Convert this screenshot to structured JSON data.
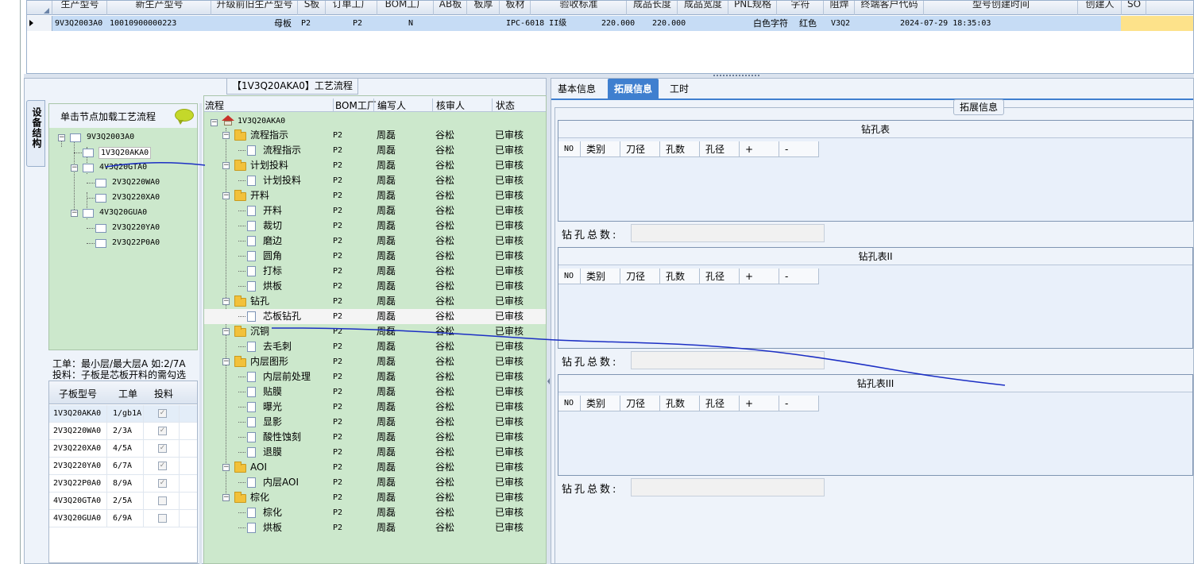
{
  "top_grid": {
    "headers": [
      "生产型号",
      "新生产型号",
      "升级前旧生产型号",
      "S板",
      "订单工厂",
      "BOM工厂",
      "AB板",
      "板厚",
      "板材",
      "验收标准",
      "成品长度",
      "成品宽度",
      "PNL规格",
      "字符",
      "阻焊",
      "终端客户代码",
      "型号创建时间",
      "创建人",
      "SO"
    ],
    "row": {
      "model": "9V3Q2003A0",
      "new_model": "10010900000223",
      "board_type": "母板",
      "order_factory": "P2",
      "bom_factory": "P2",
      "ab_board": "N",
      "standard": "IPC-6018 II级",
      "length": "220.000",
      "width": "220.000",
      "character": "白色字符",
      "solder_mask": "红色",
      "customer_code": "V3Q2",
      "created_time": "2024-07-29 18:35:03"
    }
  },
  "left_panel": {
    "title": "【1V3Q20AKA0】工艺流程",
    "vertical_tab": "设备结构",
    "hint": "单击节点加载工艺流程",
    "tree": [
      {
        "label": "9V3Q2003A0"
      },
      {
        "label": "1V3Q20AKA0"
      },
      {
        "label": "4V3Q20GTA0"
      },
      {
        "label": "2V3Q220WA0"
      },
      {
        "label": "2V3Q220XA0"
      },
      {
        "label": "4V3Q20GUA0"
      },
      {
        "label": "2V3Q220YA0"
      },
      {
        "label": "2V3Q22P0A0"
      }
    ],
    "note_line1": "工单：最小层/最大层A 如:2/7A",
    "note_line2": "投料：子板是芯板开料的需勾选",
    "sub_table": {
      "headers": [
        "子板型号",
        "工单",
        "投料"
      ],
      "rows": [
        {
          "model": "1V3Q20AKA0",
          "order": "1/gb1A",
          "feed": true
        },
        {
          "model": "2V3Q220WA0",
          "order": "2/3A",
          "feed": true
        },
        {
          "model": "2V3Q220XA0",
          "order": "4/5A",
          "feed": true
        },
        {
          "model": "2V3Q220YA0",
          "order": "6/7A",
          "feed": true
        },
        {
          "model": "2V3Q22P0A0",
          "order": "8/9A",
          "feed": true
        },
        {
          "model": "4V3Q20GTA0",
          "order": "2/5A",
          "feed": false
        },
        {
          "model": "4V3Q20GUA0",
          "order": "6/9A",
          "feed": false
        }
      ],
      "check_mark": "✓"
    },
    "flow": {
      "headers": [
        "流程",
        "BOM工厂",
        "编写人",
        "核审人",
        "状态"
      ],
      "root": "1V3Q20AKA0",
      "rows": [
        {
          "name": "流程指示",
          "type": "folder",
          "factory": "P2",
          "writer": "周磊",
          "reviewer": "谷松",
          "status": "已审核"
        },
        {
          "name": "流程指示",
          "type": "doc",
          "factory": "P2",
          "writer": "周磊",
          "reviewer": "谷松",
          "status": "已审核"
        },
        {
          "name": "计划投料",
          "type": "folder",
          "factory": "P2",
          "writer": "周磊",
          "reviewer": "谷松",
          "status": "已审核"
        },
        {
          "name": "计划投料",
          "type": "doc",
          "factory": "P2",
          "writer": "周磊",
          "reviewer": "谷松",
          "status": "已审核"
        },
        {
          "name": "开料",
          "type": "folder",
          "factory": "P2",
          "writer": "周磊",
          "reviewer": "谷松",
          "status": "已审核"
        },
        {
          "name": "开料",
          "type": "doc",
          "factory": "P2",
          "writer": "周磊",
          "reviewer": "谷松",
          "status": "已审核"
        },
        {
          "name": "裁切",
          "type": "doc",
          "factory": "P2",
          "writer": "周磊",
          "reviewer": "谷松",
          "status": "已审核"
        },
        {
          "name": "磨边",
          "type": "doc",
          "factory": "P2",
          "writer": "周磊",
          "reviewer": "谷松",
          "status": "已审核"
        },
        {
          "name": "圆角",
          "type": "doc",
          "factory": "P2",
          "writer": "周磊",
          "reviewer": "谷松",
          "status": "已审核"
        },
        {
          "name": "打标",
          "type": "doc",
          "factory": "P2",
          "writer": "周磊",
          "reviewer": "谷松",
          "status": "已审核"
        },
        {
          "name": "烘板",
          "type": "doc",
          "factory": "P2",
          "writer": "周磊",
          "reviewer": "谷松",
          "status": "已审核"
        },
        {
          "name": "钻孔",
          "type": "folder",
          "factory": "P2",
          "writer": "周磊",
          "reviewer": "谷松",
          "status": "已审核"
        },
        {
          "name": "芯板钻孔",
          "type": "doc",
          "factory": "P2",
          "writer": "周磊",
          "reviewer": "谷松",
          "status": "已审核"
        },
        {
          "name": "沉铜",
          "type": "folder",
          "factory": "P2",
          "writer": "周磊",
          "reviewer": "谷松",
          "status": "已审核"
        },
        {
          "name": "去毛刺",
          "type": "doc",
          "factory": "P2",
          "writer": "周磊",
          "reviewer": "谷松",
          "status": "已审核"
        },
        {
          "name": "内层图形",
          "type": "folder",
          "factory": "P2",
          "writer": "周磊",
          "reviewer": "谷松",
          "status": "已审核"
        },
        {
          "name": "内层前处理",
          "type": "doc",
          "factory": "P2",
          "writer": "周磊",
          "reviewer": "谷松",
          "status": "已审核"
        },
        {
          "name": "贴膜",
          "type": "doc",
          "factory": "P2",
          "writer": "周磊",
          "reviewer": "谷松",
          "status": "已审核"
        },
        {
          "name": "曝光",
          "type": "doc",
          "factory": "P2",
          "writer": "周磊",
          "reviewer": "谷松",
          "status": "已审核"
        },
        {
          "name": "显影",
          "type": "doc",
          "factory": "P2",
          "writer": "周磊",
          "reviewer": "谷松",
          "status": "已审核"
        },
        {
          "name": "酸性蚀刻",
          "type": "doc",
          "factory": "P2",
          "writer": "周磊",
          "reviewer": "谷松",
          "status": "已审核"
        },
        {
          "name": "退膜",
          "type": "doc",
          "factory": "P2",
          "writer": "周磊",
          "reviewer": "谷松",
          "status": "已审核"
        },
        {
          "name": "AOI",
          "type": "folder",
          "factory": "P2",
          "writer": "周磊",
          "reviewer": "谷松",
          "status": "已审核"
        },
        {
          "name": "内层AOI",
          "type": "doc",
          "factory": "P2",
          "writer": "周磊",
          "reviewer": "谷松",
          "status": "已审核"
        },
        {
          "name": "棕化",
          "type": "folder",
          "factory": "P2",
          "writer": "周磊",
          "reviewer": "谷松",
          "status": "已审核"
        },
        {
          "name": "棕化",
          "type": "doc",
          "factory": "P2",
          "writer": "周磊",
          "reviewer": "谷松",
          "status": "已审核"
        },
        {
          "name": "烘板",
          "type": "doc",
          "factory": "P2",
          "writer": "周磊",
          "reviewer": "谷松",
          "status": "已审核"
        }
      ]
    }
  },
  "right_panel": {
    "tabs": [
      "基本信息",
      "拓展信息",
      "工时"
    ],
    "active_tab": 1,
    "section_title": "拓展信息",
    "drill_tables": [
      {
        "title": "钻孔表",
        "total_label": "钻孔总数:"
      },
      {
        "title": "钻孔表II",
        "total_label": "钻孔总数:"
      },
      {
        "title": "钻孔表III",
        "total_label": "钻孔总数:"
      }
    ],
    "drill_headers": [
      "NO",
      "类别",
      "刀径",
      "孔数",
      "孔径",
      "+",
      "-"
    ]
  },
  "colors": {
    "tree_green": "#cce8cc",
    "selection_blue": "#c6dcf5",
    "tab_active": "#3f7fcf",
    "annotation_stroke": "#1c2fc4"
  }
}
